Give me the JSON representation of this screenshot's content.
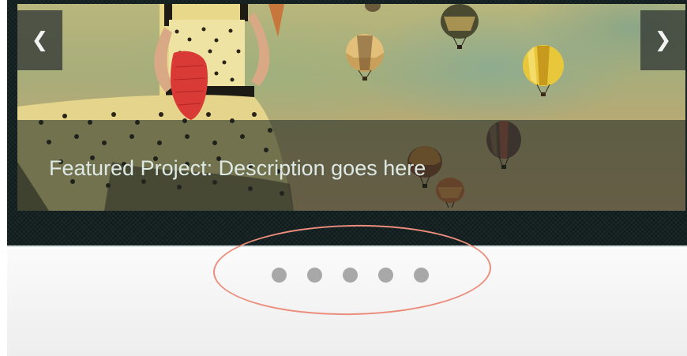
{
  "slider": {
    "caption": "Featured Project: Description goes here",
    "prev_label": "❮",
    "next_label": "❯",
    "current_slide": 1,
    "slide_count": 5
  },
  "pager": {
    "dots": [
      {
        "index": 1
      },
      {
        "index": 2
      },
      {
        "index": 3
      },
      {
        "index": 4
      },
      {
        "index": 5
      }
    ]
  },
  "annotation": {
    "color": "#ec8d7c",
    "shape": "ellipse-around-pager"
  },
  "colors": {
    "frame": "#0e1a1b",
    "dot": "#a8a8a8",
    "caption_text": "#dde9e4"
  }
}
